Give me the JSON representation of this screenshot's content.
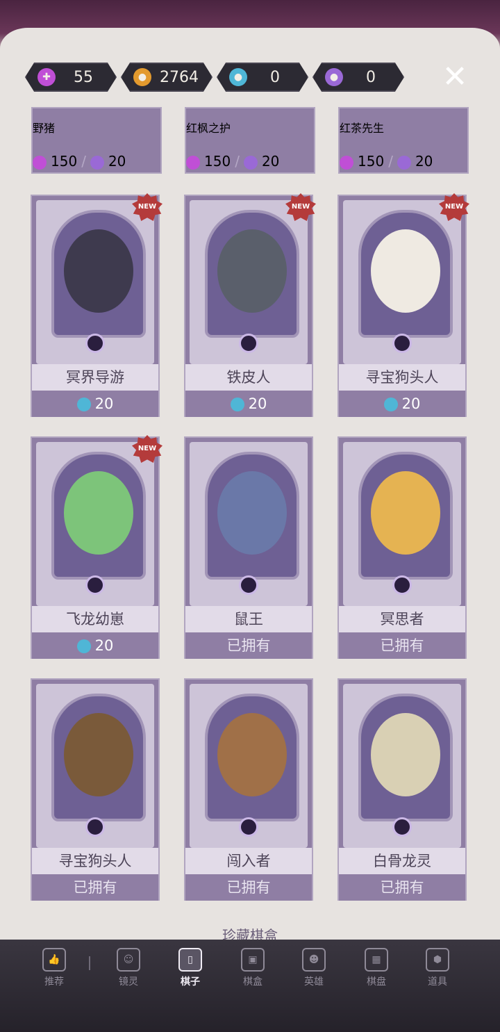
{
  "currencies": [
    {
      "icon": "candy-plus-icon",
      "value": "55",
      "color": "#c04fd6"
    },
    {
      "icon": "pumpkin-coin-icon",
      "value": "2764",
      "color": "#e39a2e"
    },
    {
      "icon": "blue-bomb-bag-icon",
      "value": "0",
      "color": "#4fb6d6"
    },
    {
      "icon": "purple-bomb-bag-icon",
      "value": "0",
      "color": "#9a69d6"
    }
  ],
  "top_row": [
    {
      "name": "野猪",
      "price_a": "150",
      "price_b": "20"
    },
    {
      "name": "红枫之护",
      "price_a": "150",
      "price_b": "20"
    },
    {
      "name": "红茶先生",
      "price_a": "150",
      "price_b": "20"
    }
  ],
  "cards": [
    {
      "name": "冥界导游",
      "price": "20",
      "new": "NEW",
      "owned": false,
      "color": "#3e3a4e"
    },
    {
      "name": "铁皮人",
      "price": "20",
      "new": "NEW",
      "owned": false,
      "color": "#5a5f6b"
    },
    {
      "name": "寻宝狗头人",
      "price": "20",
      "new": "NEW",
      "owned": false,
      "color": "#efeae2"
    },
    {
      "name": "飞龙幼崽",
      "price": "20",
      "new": "NEW",
      "owned": false,
      "color": "#7dc47a"
    },
    {
      "name": "鼠王",
      "owned_label": "已拥有",
      "owned": true,
      "color": "#6a78a8"
    },
    {
      "name": "冥思者",
      "owned_label": "已拥有",
      "owned": true,
      "color": "#e5b352"
    },
    {
      "name": "寻宝狗头人",
      "owned_label": "已拥有",
      "owned": true,
      "color": "#7a5a3a"
    },
    {
      "name": "闯入者",
      "owned_label": "已拥有",
      "owned": true,
      "color": "#a07048"
    },
    {
      "name": "白骨龙灵",
      "owned_label": "已拥有",
      "owned": true,
      "color": "#d9d0b4"
    }
  ],
  "section_title": "珍藏棋盒",
  "nav": [
    {
      "label": "推荐",
      "icon": "thumbs-up-icon"
    },
    {
      "label": "镜灵",
      "icon": "spirit-icon"
    },
    {
      "label": "棋子",
      "icon": "chess-piece-card-icon"
    },
    {
      "label": "棋盒",
      "icon": "chess-box-icon"
    },
    {
      "label": "英雄",
      "icon": "hero-icon"
    },
    {
      "label": "棋盘",
      "icon": "board-icon"
    },
    {
      "label": "道具",
      "icon": "item-icon"
    }
  ],
  "active_nav": "棋子"
}
